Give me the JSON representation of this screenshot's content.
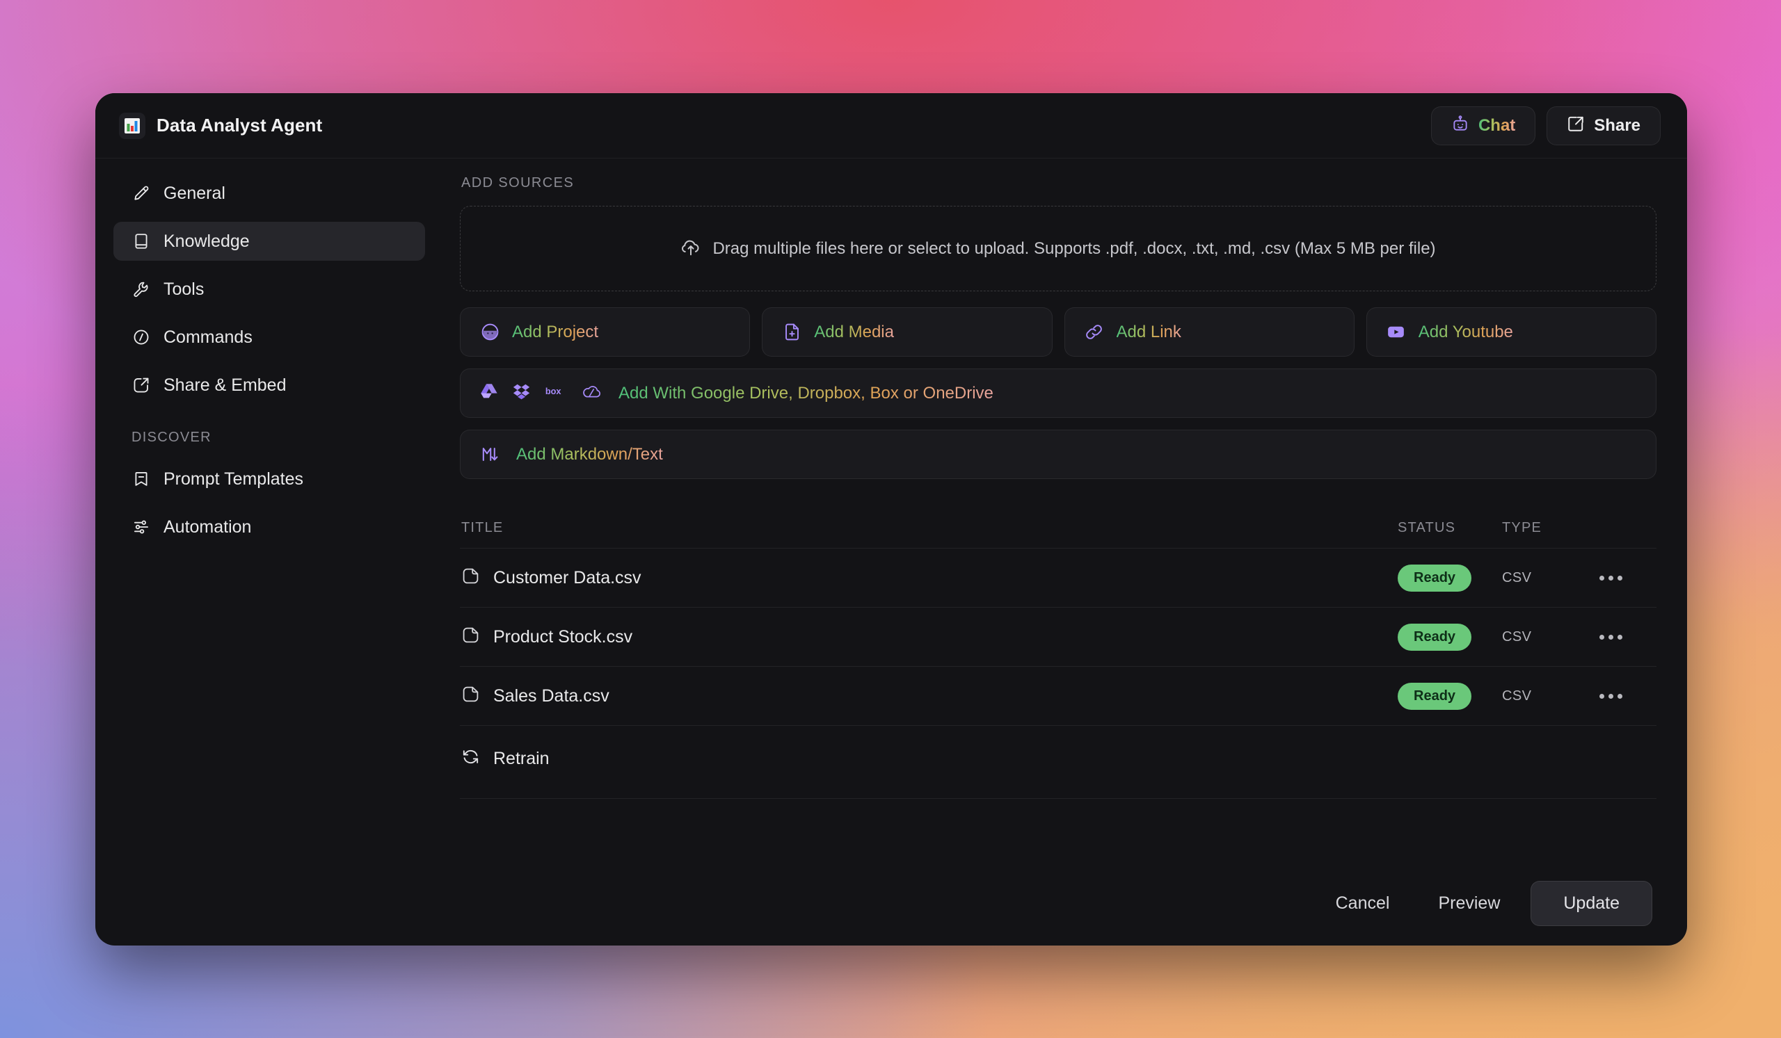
{
  "window": {
    "title": "Data Analyst Agent",
    "logo_icon": "bar-chart-emoji"
  },
  "titlebar": {
    "chat_label": "Chat",
    "chat_icon": "robot-icon",
    "share_label": "Share",
    "share_icon": "share-arrow-icon"
  },
  "sidebar": {
    "items": [
      {
        "label": "General",
        "icon": "pencil-icon",
        "active": false
      },
      {
        "label": "Knowledge",
        "icon": "book-icon",
        "active": true
      },
      {
        "label": "Tools",
        "icon": "wrench-icon",
        "active": false
      },
      {
        "label": "Commands",
        "icon": "slash-circle-icon",
        "active": false
      },
      {
        "label": "Share & Embed",
        "icon": "share-arrow-icon",
        "active": false
      }
    ],
    "section_label": "DISCOVER",
    "discover_items": [
      {
        "label": "Prompt Templates",
        "icon": "bookmark-minus-icon"
      },
      {
        "label": "Automation",
        "icon": "automation-nodes-icon"
      }
    ]
  },
  "main": {
    "section_label": "ADD SOURCES",
    "dropzone": {
      "icon": "upload-cloud-icon",
      "text": "Drag multiple files here or select to upload. Supports .pdf, .docx, .txt, .md, .csv (Max 5 MB per file)"
    },
    "source_buttons": [
      {
        "label": "Add Project",
        "icon": "project-avatar-icon"
      },
      {
        "label": "Add Media",
        "icon": "file-plus-icon"
      },
      {
        "label": "Add Link",
        "icon": "link-icon"
      },
      {
        "label": "Add Youtube",
        "icon": "youtube-icon"
      }
    ],
    "cloud_row": {
      "label": "Add With Google Drive, Dropbox, Box or OneDrive",
      "icons": [
        "google-drive-icon",
        "dropbox-icon",
        "box-icon",
        "onedrive-icon"
      ]
    },
    "markdown_row": {
      "label": "Add Markdown/Text",
      "icon": "markdown-icon"
    }
  },
  "table": {
    "headers": {
      "title": "TITLE",
      "status": "STATUS",
      "type": "TYPE"
    },
    "rows": [
      {
        "name": "Customer Data.csv",
        "status": "Ready",
        "type": "CSV",
        "icon": "file-icon",
        "menu_icon": "more-horizontal-icon"
      },
      {
        "name": "Product Stock.csv",
        "status": "Ready",
        "type": "CSV",
        "icon": "file-icon",
        "menu_icon": "more-horizontal-icon"
      },
      {
        "name": "Sales Data.csv",
        "status": "Ready",
        "type": "CSV",
        "icon": "file-icon",
        "menu_icon": "more-horizontal-icon"
      }
    ],
    "retrain": {
      "label": "Retrain",
      "icon": "refresh-icon"
    }
  },
  "footer": {
    "cancel_label": "Cancel",
    "preview_label": "Preview",
    "update_label": "Update"
  },
  "colors": {
    "window_bg": "#131316",
    "panel_bg": "#1a1a1e",
    "active_nav": "#26262b",
    "badge_green": "#6ac87a",
    "accent_purple": "#a78bfa",
    "gradient_start": "#4ec07a",
    "gradient_end": "#e8a49e",
    "muted_text": "#8b8b93"
  }
}
